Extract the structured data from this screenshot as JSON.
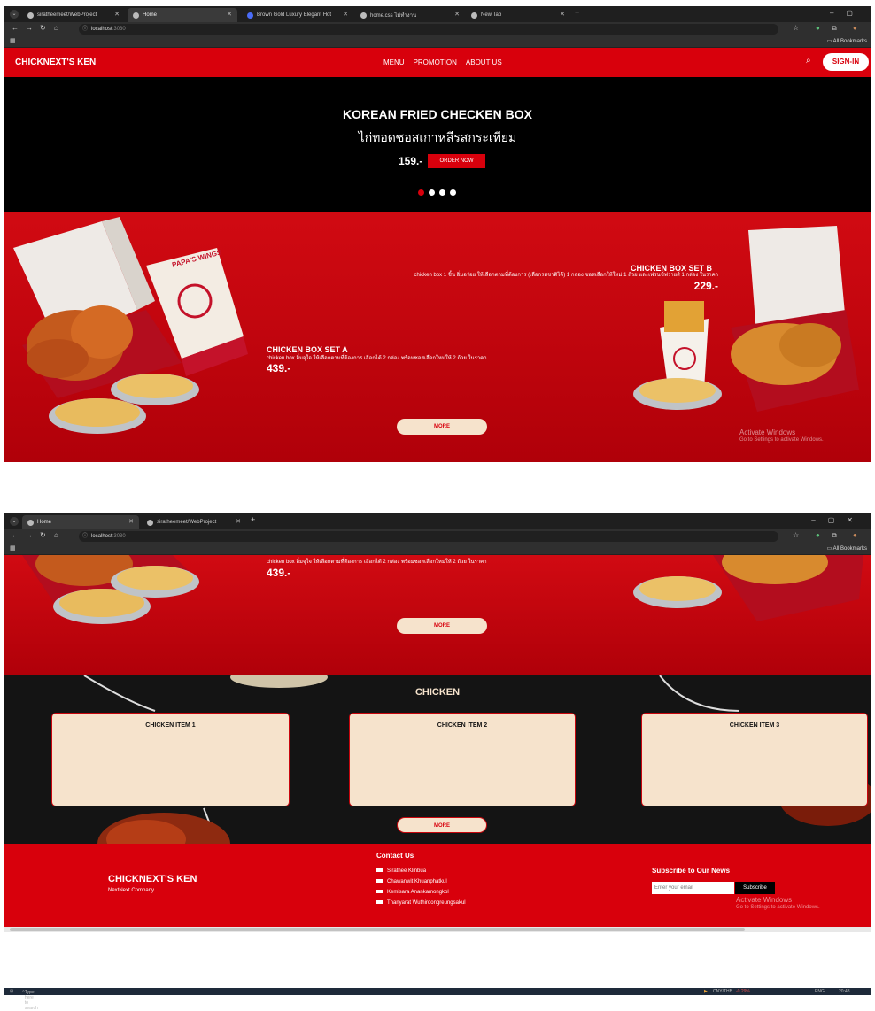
{
  "window1": {
    "tabs": [
      {
        "label": "siratheemeet/WebProject"
      },
      {
        "label": "Home"
      },
      {
        "label": "Brown Gold Luxury Elegant Hot"
      },
      {
        "label": "home.css ไม่ทำงาน"
      },
      {
        "label": "New Tab"
      }
    ],
    "url": "localhost",
    "url_port": ":3030",
    "all_bookmarks": "All Bookmarks"
  },
  "window2": {
    "tabs": [
      {
        "label": "Home"
      },
      {
        "label": "siratheemeet/WebProject"
      }
    ],
    "url": "localhost",
    "url_port": ":3030",
    "all_bookmarks": "All Bookmarks"
  },
  "site": {
    "brand": "CHICKNEXT'S KEN",
    "menu": [
      "MENU",
      "PROMOTION",
      "ABOUT US"
    ],
    "signin": "SIGN-IN",
    "hero": {
      "title": "KOREAN FRIED CHECKEN BOX",
      "subtitle": "ไก่ทอดซอสเกาหลีรสกระเทียม",
      "price": "159.-",
      "order_button": "ORDER NOW"
    },
    "promo": {
      "set_b": {
        "name": "CHICKEN BOX SET B",
        "desc": "chicken box 1 ชิ้น อิ่มอร่อย ให้เลือกตามที่ต้องการ (เลือกรสชาติได้) 1 กล่อง ซอสเลือกให้ใหม่ 1 ถ้วย และเฟรนช์ฟรายส์ 1 กล่อง ในราคา",
        "price": "229.-"
      },
      "set_a": {
        "name": "CHICKEN BOX SET A",
        "desc": "chicken box อิ่มจุใจ ให้เลือกตามที่ต้องการ เลือกได้ 2 กล่อง พร้อมซอสเลือกใหม่ให้ 2 ถ้วย ในราคา",
        "price": "439.-"
      },
      "more": "MORE",
      "box_brand": "PAPA'S WINGS"
    },
    "chicken": {
      "title": "CHICKEN",
      "items": [
        "CHICKEN ITEM 1",
        "CHICKEN ITEM 2",
        "CHICKEN ITEM 3"
      ],
      "more": "MORE"
    },
    "footer": {
      "brand": "CHICKNEXT'S KEN",
      "company": "NextNext Company",
      "contact_title": "Contact Us",
      "contacts": [
        "Sirathee Klinbua",
        "Chawanwit Khuanphatkul",
        "Kemisara Anankamongkol",
        "Thanyarat Wuthiroongreungsakul"
      ],
      "newsletter_title": "Subscribe to Our News",
      "email_placeholder": "Enter your email",
      "subscribe": "Subscribe"
    }
  },
  "activate": {
    "title": "Activate Windows",
    "sub": "Go to Settings to activate Windows."
  },
  "taskbar": {
    "search": "Type here to search",
    "ticker": "CNY/THB",
    "ticker_change": "-0.29%",
    "lang": "ENG",
    "time": "20:48"
  }
}
